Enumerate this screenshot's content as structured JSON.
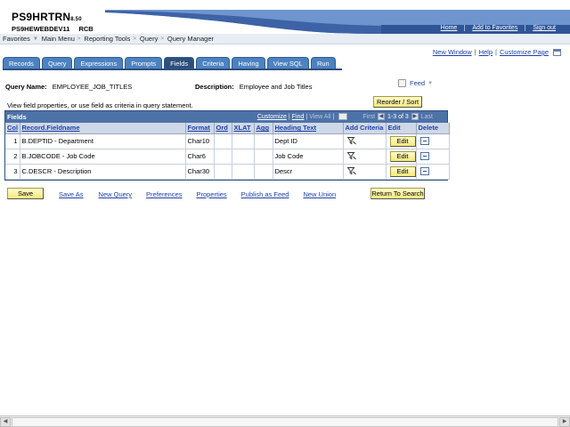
{
  "header": {
    "environment": "PS9HRTRN",
    "version": "8.50",
    "database": "PS9HEWEBDEV11",
    "instance": "RCB",
    "links": [
      "Home",
      "Add to Favorites",
      "Sign out"
    ]
  },
  "menubar": {
    "items": [
      "Favorites",
      "Main Menu",
      "Reporting Tools",
      "Query",
      "Query Manager"
    ]
  },
  "utility": {
    "new_window": "New Window",
    "help": "Help",
    "customize_page": "Customize Page"
  },
  "tabs": [
    "Records",
    "Query",
    "Expressions",
    "Prompts",
    "Fields",
    "Criteria",
    "Having",
    "View SQL",
    "Run"
  ],
  "active_tab": "Fields",
  "query": {
    "name_label": "Query Name:",
    "name_value": "EMPLOYEE_JOB_TITLES",
    "desc_label": "Description:",
    "desc_value": "Employee and Job Titles",
    "feed_label": "Feed",
    "reorder_button": "Reorder / Sort",
    "hint": "View field properties, or use field as criteria in query statement."
  },
  "grid": {
    "title": "Fields",
    "nav": {
      "customize": "Customize",
      "find": "Find",
      "view_all": "View All",
      "first": "First",
      "range": "1-3 of 3",
      "last": "Last"
    },
    "columns": [
      "Col",
      "Record.Fieldname",
      "Format",
      "Ord",
      "XLAT",
      "Agg",
      "Heading Text",
      "Add Criteria",
      "Edit",
      "Delete"
    ],
    "rows": [
      {
        "col": "1",
        "field": "B.DEPTID - Department",
        "format": "Char10",
        "ord": "",
        "xlat": "",
        "agg": "",
        "heading": "Dept ID",
        "edit": "Edit"
      },
      {
        "col": "2",
        "field": "B.JOBCODE - Job Code",
        "format": "Char6",
        "ord": "",
        "xlat": "",
        "agg": "",
        "heading": "Job Code",
        "edit": "Edit"
      },
      {
        "col": "3",
        "field": "C.DESCR - Description",
        "format": "Char30",
        "ord": "",
        "xlat": "",
        "agg": "",
        "heading": "Descr",
        "edit": "Edit"
      }
    ]
  },
  "actions": {
    "save": "Save",
    "save_as": "Save As",
    "new_query": "New Query",
    "preferences": "Preferences",
    "properties": "Properties",
    "publish_as_feed": "Publish as Feed",
    "new_union": "New Union",
    "return_to_search": "Return To Search"
  },
  "colors": {
    "tab_blue": "#4d82c1",
    "tab_active": "#2d4f7c",
    "grid_header": "#4d72a8",
    "button_yellow": "#f5e97a",
    "link_blue": "#1f3fa8"
  }
}
